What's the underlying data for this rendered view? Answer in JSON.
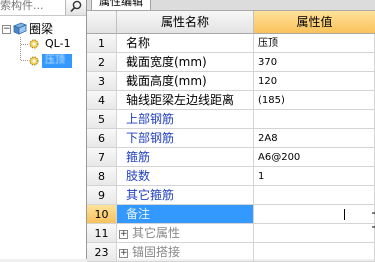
{
  "search": {
    "text": "索构件..."
  },
  "tree": {
    "root": {
      "label": "圈梁",
      "expand_symbol": "−"
    },
    "children": [
      {
        "label": "QL-1"
      },
      {
        "label": "压顶"
      }
    ]
  },
  "tab": {
    "label": "属性编辑"
  },
  "grid": {
    "headers": {
      "name": "属性名称",
      "value": "属性值"
    },
    "rows": [
      {
        "num": "1",
        "name": "名称",
        "value": "压顶",
        "style": "black"
      },
      {
        "num": "2",
        "name": "截面宽度(mm)",
        "value": "370",
        "style": "black"
      },
      {
        "num": "3",
        "name": "截面高度(mm)",
        "value": "120",
        "style": "black"
      },
      {
        "num": "4",
        "name": "轴线距梁左边线距离",
        "value": "(185)",
        "style": "black"
      },
      {
        "num": "5",
        "name": "上部钢筋",
        "value": "",
        "style": "blue"
      },
      {
        "num": "6",
        "name": "下部钢筋",
        "value": "2A8",
        "style": "blue"
      },
      {
        "num": "7",
        "name": "箍筋",
        "value": "A6@200",
        "style": "blue"
      },
      {
        "num": "8",
        "name": "肢数",
        "value": "1",
        "style": "blue"
      },
      {
        "num": "9",
        "name": "其它箍筋",
        "value": "",
        "style": "blue"
      },
      {
        "num": "10",
        "name": "备注",
        "value": "",
        "style": "selected"
      },
      {
        "num": "11",
        "name": "其它属性",
        "value": "",
        "style": "group",
        "expander": "+"
      },
      {
        "num": "23",
        "name": "锚固搭接",
        "value": "",
        "style": "group",
        "expander": "+"
      }
    ]
  },
  "colors": {
    "selection": "#3399ff",
    "accent_header": "#f9c25c",
    "rebar_text": "#1f3fbf"
  }
}
